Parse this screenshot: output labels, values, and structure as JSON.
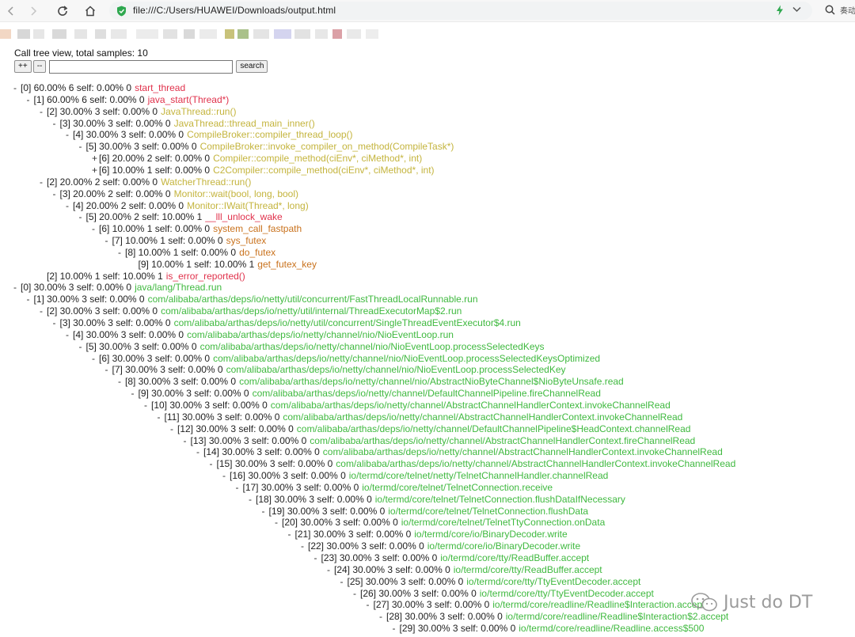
{
  "browser": {
    "url": "file:///C:/Users/HUAWEI/Downloads/output.html",
    "search_engine_label": "奏动"
  },
  "page": {
    "header": "Call tree view, total samples: 10",
    "expand_label": "++",
    "collapse_label": "--",
    "search_value": "",
    "search_button": "search"
  },
  "colors": {
    "red": "#e0314b",
    "olive": "#c4b43d",
    "orange": "#c9721d",
    "green": "#3fb93f"
  },
  "tree": [
    {
      "depth": 0,
      "toggle": "-",
      "stats": "[0] 60.00% 6 self: 0.00% 0",
      "fn": "start_thread",
      "color": "red"
    },
    {
      "depth": 1,
      "toggle": "-",
      "stats": "[1] 60.00% 6 self: 0.00% 0",
      "fn": "java_start(Thread*)",
      "color": "red"
    },
    {
      "depth": 2,
      "toggle": "-",
      "stats": "[2] 30.00% 3 self: 0.00% 0",
      "fn": "JavaThread::run()",
      "color": "olive"
    },
    {
      "depth": 3,
      "toggle": "-",
      "stats": "[3] 30.00% 3 self: 0.00% 0",
      "fn": "JavaThread::thread_main_inner()",
      "color": "olive"
    },
    {
      "depth": 4,
      "toggle": "-",
      "stats": "[4] 30.00% 3 self: 0.00% 0",
      "fn": "CompileBroker::compiler_thread_loop()",
      "color": "olive"
    },
    {
      "depth": 5,
      "toggle": "-",
      "stats": "[5] 30.00% 3 self: 0.00% 0",
      "fn": "CompileBroker::invoke_compiler_on_method(CompileTask*)",
      "color": "olive"
    },
    {
      "depth": 6,
      "toggle": "+",
      "stats": "[6] 20.00% 2 self: 0.00% 0",
      "fn": "Compiler::compile_method(ciEnv*, ciMethod*, int)",
      "color": "olive"
    },
    {
      "depth": 6,
      "toggle": "+",
      "stats": "[6] 10.00% 1 self: 0.00% 0",
      "fn": "C2Compiler::compile_method(ciEnv*, ciMethod*, int)",
      "color": "olive"
    },
    {
      "depth": 2,
      "toggle": "-",
      "stats": "[2] 20.00% 2 self: 0.00% 0",
      "fn": "WatcherThread::run()",
      "color": "olive"
    },
    {
      "depth": 3,
      "toggle": "-",
      "stats": "[3] 20.00% 2 self: 0.00% 0",
      "fn": "Monitor::wait(bool, long, bool)",
      "color": "olive"
    },
    {
      "depth": 4,
      "toggle": "-",
      "stats": "[4] 20.00% 2 self: 0.00% 0",
      "fn": "Monitor::IWait(Thread*, long)",
      "color": "olive"
    },
    {
      "depth": 5,
      "toggle": "-",
      "stats": "[5] 20.00% 2 self: 10.00% 1",
      "fn": "__lll_unlock_wake",
      "color": "red"
    },
    {
      "depth": 6,
      "toggle": "-",
      "stats": "[6] 10.00% 1 self: 0.00% 0",
      "fn": "system_call_fastpath",
      "color": "orange"
    },
    {
      "depth": 7,
      "toggle": "-",
      "stats": "[7] 10.00% 1 self: 0.00% 0",
      "fn": "sys_futex",
      "color": "orange"
    },
    {
      "depth": 8,
      "toggle": "-",
      "stats": "[8] 10.00% 1 self: 0.00% 0",
      "fn": "do_futex",
      "color": "orange"
    },
    {
      "depth": 9,
      "toggle": "",
      "stats": "[9] 10.00% 1 self: 10.00% 1",
      "fn": "get_futex_key",
      "color": "orange"
    },
    {
      "depth": 2,
      "toggle": "",
      "stats": "[2] 10.00% 1 self: 10.00% 1",
      "fn": "is_error_reported()",
      "color": "red"
    },
    {
      "depth": 0,
      "toggle": "-",
      "stats": "[0] 30.00% 3 self: 0.00% 0",
      "fn": "java/lang/Thread.run",
      "color": "green"
    },
    {
      "depth": 1,
      "toggle": "-",
      "stats": "[1] 30.00% 3 self: 0.00% 0",
      "fn": "com/alibaba/arthas/deps/io/netty/util/concurrent/FastThreadLocalRunnable.run",
      "color": "green"
    },
    {
      "depth": 2,
      "toggle": "-",
      "stats": "[2] 30.00% 3 self: 0.00% 0",
      "fn": "com/alibaba/arthas/deps/io/netty/util/internal/ThreadExecutorMap$2.run",
      "color": "green"
    },
    {
      "depth": 3,
      "toggle": "-",
      "stats": "[3] 30.00% 3 self: 0.00% 0",
      "fn": "com/alibaba/arthas/deps/io/netty/util/concurrent/SingleThreadEventExecutor$4.run",
      "color": "green"
    },
    {
      "depth": 4,
      "toggle": "-",
      "stats": "[4] 30.00% 3 self: 0.00% 0",
      "fn": "com/alibaba/arthas/deps/io/netty/channel/nio/NioEventLoop.run",
      "color": "green"
    },
    {
      "depth": 5,
      "toggle": "-",
      "stats": "[5] 30.00% 3 self: 0.00% 0",
      "fn": "com/alibaba/arthas/deps/io/netty/channel/nio/NioEventLoop.processSelectedKeys",
      "color": "green"
    },
    {
      "depth": 6,
      "toggle": "-",
      "stats": "[6] 30.00% 3 self: 0.00% 0",
      "fn": "com/alibaba/arthas/deps/io/netty/channel/nio/NioEventLoop.processSelectedKeysOptimized",
      "color": "green"
    },
    {
      "depth": 7,
      "toggle": "-",
      "stats": "[7] 30.00% 3 self: 0.00% 0",
      "fn": "com/alibaba/arthas/deps/io/netty/channel/nio/NioEventLoop.processSelectedKey",
      "color": "green"
    },
    {
      "depth": 8,
      "toggle": "-",
      "stats": "[8] 30.00% 3 self: 0.00% 0",
      "fn": "com/alibaba/arthas/deps/io/netty/channel/nio/AbstractNioByteChannel$NioByteUnsafe.read",
      "color": "green"
    },
    {
      "depth": 9,
      "toggle": "-",
      "stats": "[9] 30.00% 3 self: 0.00% 0",
      "fn": "com/alibaba/arthas/deps/io/netty/channel/DefaultChannelPipeline.fireChannelRead",
      "color": "green"
    },
    {
      "depth": 10,
      "toggle": "-",
      "stats": "[10] 30.00% 3 self: 0.00% 0",
      "fn": "com/alibaba/arthas/deps/io/netty/channel/AbstractChannelHandlerContext.invokeChannelRead",
      "color": "green"
    },
    {
      "depth": 11,
      "toggle": "-",
      "stats": "[11] 30.00% 3 self: 0.00% 0",
      "fn": "com/alibaba/arthas/deps/io/netty/channel/AbstractChannelHandlerContext.invokeChannelRead",
      "color": "green"
    },
    {
      "depth": 12,
      "toggle": "-",
      "stats": "[12] 30.00% 3 self: 0.00% 0",
      "fn": "com/alibaba/arthas/deps/io/netty/channel/DefaultChannelPipeline$HeadContext.channelRead",
      "color": "green"
    },
    {
      "depth": 13,
      "toggle": "-",
      "stats": "[13] 30.00% 3 self: 0.00% 0",
      "fn": "com/alibaba/arthas/deps/io/netty/channel/AbstractChannelHandlerContext.fireChannelRead",
      "color": "green"
    },
    {
      "depth": 14,
      "toggle": "-",
      "stats": "[14] 30.00% 3 self: 0.00% 0",
      "fn": "com/alibaba/arthas/deps/io/netty/channel/AbstractChannelHandlerContext.invokeChannelRead",
      "color": "green"
    },
    {
      "depth": 15,
      "toggle": "-",
      "stats": "[15] 30.00% 3 self: 0.00% 0",
      "fn": "com/alibaba/arthas/deps/io/netty/channel/AbstractChannelHandlerContext.invokeChannelRead",
      "color": "green"
    },
    {
      "depth": 16,
      "toggle": "-",
      "stats": "[16] 30.00% 3 self: 0.00% 0",
      "fn": "io/termd/core/telnet/netty/TelnetChannelHandler.channelRead",
      "color": "green"
    },
    {
      "depth": 17,
      "toggle": "-",
      "stats": "[17] 30.00% 3 self: 0.00% 0",
      "fn": "io/termd/core/telnet/TelnetConnection.receive",
      "color": "green"
    },
    {
      "depth": 18,
      "toggle": "-",
      "stats": "[18] 30.00% 3 self: 0.00% 0",
      "fn": "io/termd/core/telnet/TelnetConnection.flushDataIfNecessary",
      "color": "green"
    },
    {
      "depth": 19,
      "toggle": "-",
      "stats": "[19] 30.00% 3 self: 0.00% 0",
      "fn": "io/termd/core/telnet/TelnetConnection.flushData",
      "color": "green"
    },
    {
      "depth": 20,
      "toggle": "-",
      "stats": "[20] 30.00% 3 self: 0.00% 0",
      "fn": "io/termd/core/telnet/TelnetTtyConnection.onData",
      "color": "green"
    },
    {
      "depth": 21,
      "toggle": "-",
      "stats": "[21] 30.00% 3 self: 0.00% 0",
      "fn": "io/termd/core/io/BinaryDecoder.write",
      "color": "green"
    },
    {
      "depth": 22,
      "toggle": "-",
      "stats": "[22] 30.00% 3 self: 0.00% 0",
      "fn": "io/termd/core/io/BinaryDecoder.write",
      "color": "green"
    },
    {
      "depth": 23,
      "toggle": "-",
      "stats": "[23] 30.00% 3 self: 0.00% 0",
      "fn": "io/termd/core/tty/ReadBuffer.accept",
      "color": "green"
    },
    {
      "depth": 24,
      "toggle": "-",
      "stats": "[24] 30.00% 3 self: 0.00% 0",
      "fn": "io/termd/core/tty/ReadBuffer.accept",
      "color": "green"
    },
    {
      "depth": 25,
      "toggle": "-",
      "stats": "[25] 30.00% 3 self: 0.00% 0",
      "fn": "io/termd/core/tty/TtyEventDecoder.accept",
      "color": "green"
    },
    {
      "depth": 26,
      "toggle": "-",
      "stats": "[26] 30.00% 3 self: 0.00% 0",
      "fn": "io/termd/core/tty/TtyEventDecoder.accept",
      "color": "green"
    },
    {
      "depth": 27,
      "toggle": "-",
      "stats": "[27] 30.00% 3 self: 0.00% 0",
      "fn": "io/termd/core/readline/Readline$Interaction.accept",
      "color": "green"
    },
    {
      "depth": 28,
      "toggle": "-",
      "stats": "[28] 30.00% 3 self: 0.00% 0",
      "fn": "io/termd/core/readline/Readline$Interaction$2.accept",
      "color": "green"
    },
    {
      "depth": 29,
      "toggle": "-",
      "stats": "[29] 30.00% 3 self: 0.00% 0",
      "fn": "io/termd/core/readline/Readline.access$500",
      "color": "green"
    }
  ],
  "watermark": {
    "text": "Just do DT",
    "icon": "wechat-icon"
  }
}
